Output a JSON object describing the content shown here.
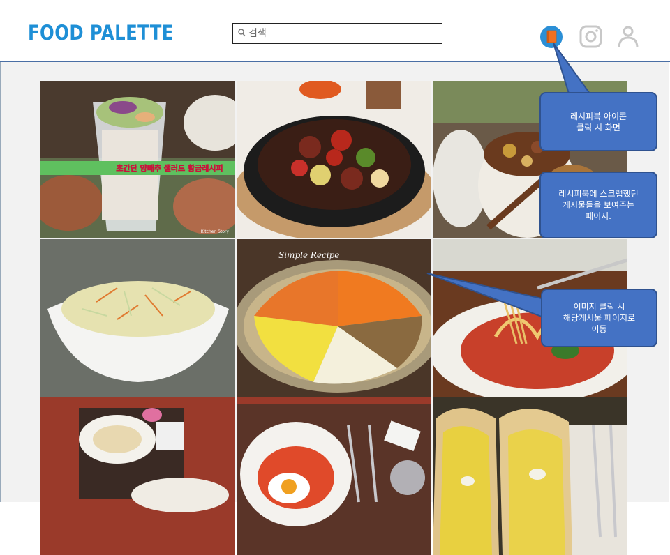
{
  "header": {
    "logo": "FOOD PALETTE",
    "search_placeholder": "검색",
    "icons": [
      "recipebook-icon",
      "instagram-icon",
      "user-icon"
    ]
  },
  "grid": {
    "tiles": [
      {
        "name": "cabbage-salad-cup",
        "caption": "초간단 양배추 샐러드 황금레시피"
      },
      {
        "name": "beef-vegetable-stirfry",
        "caption": ""
      },
      {
        "name": "clay-pot-stew",
        "caption": ""
      },
      {
        "name": "coleslaw-bowl",
        "caption": ""
      },
      {
        "name": "diced-vegetables-plate",
        "caption": "Simple Recipe"
      },
      {
        "name": "spaghetti-plate",
        "caption": ""
      },
      {
        "name": "pasta-table-setting",
        "caption": ""
      },
      {
        "name": "fried-egg-rice",
        "caption": ""
      },
      {
        "name": "egg-sandwich",
        "caption": ""
      }
    ]
  },
  "callouts": [
    {
      "text": "레시피북 아이콘\n클릭 시 화면"
    },
    {
      "text": "레시피북에 스크랩했던\n게시물들을 보여주는\n페이지."
    },
    {
      "text": "이미지 클릭 시\n해당게시물 페이지로\n이동"
    }
  ],
  "colors": {
    "accent": "#1e8fd6",
    "callout": "#4472c4",
    "callout_border": "#2f528f"
  }
}
